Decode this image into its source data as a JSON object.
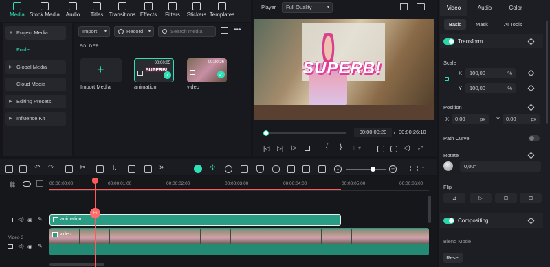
{
  "top_tabs": [
    {
      "label": "Media",
      "icon": "media-icon",
      "active": true
    },
    {
      "label": "Stock Media",
      "icon": "stock-media-icon",
      "active": false
    },
    {
      "label": "Audio",
      "icon": "audio-icon",
      "active": false
    },
    {
      "label": "Titles",
      "icon": "titles-icon",
      "active": false
    },
    {
      "label": "Transitions",
      "icon": "transitions-icon",
      "active": false
    },
    {
      "label": "Effects",
      "icon": "effects-icon",
      "active": false
    },
    {
      "label": "Filters",
      "icon": "filters-icon",
      "active": false
    },
    {
      "label": "Stickers",
      "icon": "stickers-icon",
      "active": false
    },
    {
      "label": "Templates",
      "icon": "templates-icon",
      "active": false
    }
  ],
  "sidebar": {
    "items": [
      {
        "label": "Project Media",
        "expanded": true
      },
      {
        "label": "Folder",
        "active": true
      },
      {
        "label": "Global Media"
      },
      {
        "label": "Cloud Media"
      },
      {
        "label": "Editing Presets"
      },
      {
        "label": "Influence Kit"
      }
    ]
  },
  "media_toolbar": {
    "import_label": "Import",
    "record_label": "Record",
    "search_placeholder": "Search media"
  },
  "media_grid": {
    "folder_label": "FOLDER",
    "import_tile_label": "Import Media",
    "items": [
      {
        "label": "animation",
        "duration": "00:00:05",
        "thumb_text": "SUPERB!"
      },
      {
        "label": "video",
        "duration": "00:00:26"
      }
    ]
  },
  "player": {
    "label": "Player",
    "quality": "Full Quality",
    "overlay_text": "SUPERB!",
    "current_time": "00:00:00:20",
    "total_time": "00:00:26:10",
    "progress": 0.03
  },
  "timeline": {
    "ruler_ticks": [
      "00:00:00:00",
      "00:00:01:00",
      "00:00:02:00",
      "00:00:03:00",
      "00:00:04:00",
      "00:00:05:00",
      "00:00:06:00"
    ],
    "tracks": [
      {
        "clip_label": "animation"
      },
      {
        "name": "Video 3",
        "clip_label": "video"
      }
    ]
  },
  "right_panel": {
    "tabs": [
      "Video",
      "Audio",
      "Color"
    ],
    "active_tab": "Video",
    "subtabs": [
      "Basic",
      "Mask",
      "AI Tools"
    ],
    "active_subtab": "Basic",
    "transform": {
      "title": "Transform",
      "scale_label": "Scale",
      "scale_x_label": "X",
      "scale_x": "100,00",
      "scale_y_label": "Y",
      "scale_y": "100,00",
      "scale_unit": "%",
      "position_label": "Position",
      "pos_x_label": "X",
      "pos_x": "0,00",
      "pos_y_label": "Y",
      "pos_y": "0,00",
      "pos_unit": "px",
      "path_curve_label": "Path Curve",
      "rotate_label": "Rotate",
      "rotate_value": "0,00°",
      "flip_label": "Flip"
    },
    "compositing": {
      "title": "Compositing",
      "blend_mode_label": "Blend Mode"
    },
    "reset_label": "Reset"
  },
  "colors": {
    "accent": "#2fe0b6",
    "playhead": "#ff5a5a",
    "clip_teal": "#2a9c84"
  }
}
